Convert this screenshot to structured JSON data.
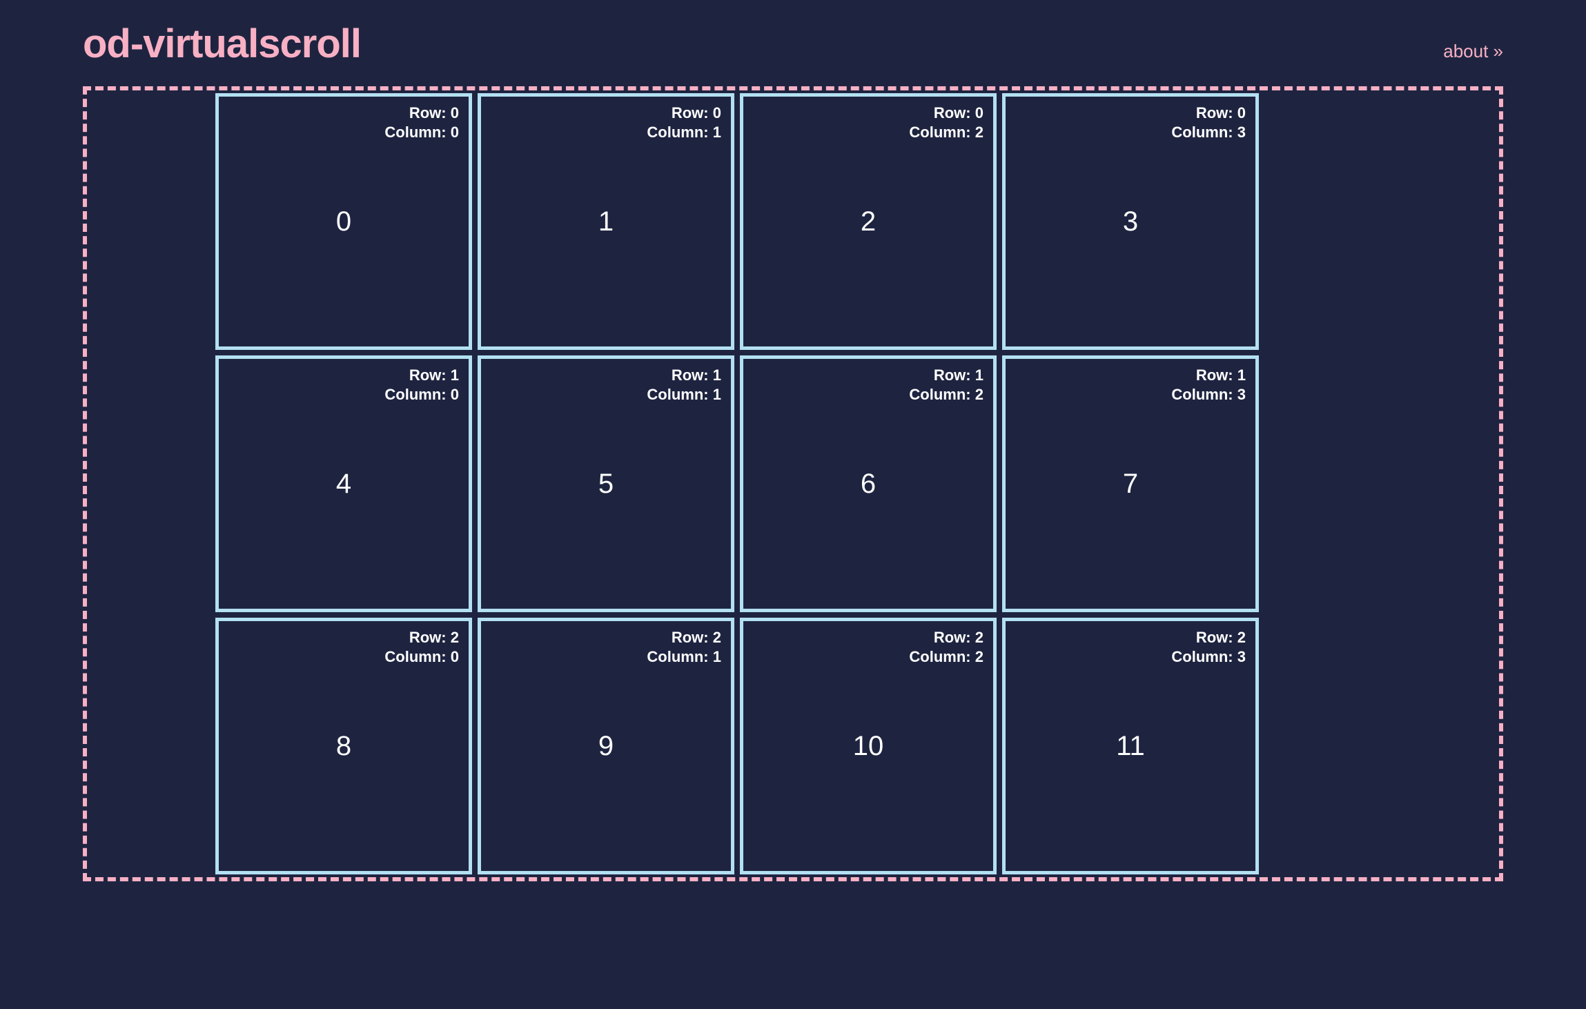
{
  "header": {
    "title": "od-virtualscroll",
    "about_label": "about »"
  },
  "labels": {
    "row_prefix": "Row: ",
    "col_prefix": "Column: "
  },
  "grid": {
    "rows": [
      {
        "row": 0,
        "cells": [
          {
            "row": 0,
            "col": 0,
            "index": 0
          },
          {
            "row": 0,
            "col": 1,
            "index": 1
          },
          {
            "row": 0,
            "col": 2,
            "index": 2
          },
          {
            "row": 0,
            "col": 3,
            "index": 3
          }
        ]
      },
      {
        "row": 1,
        "cells": [
          {
            "row": 1,
            "col": 0,
            "index": 4
          },
          {
            "row": 1,
            "col": 1,
            "index": 5
          },
          {
            "row": 1,
            "col": 2,
            "index": 6
          },
          {
            "row": 1,
            "col": 3,
            "index": 7
          }
        ]
      },
      {
        "row": 2,
        "cells": [
          {
            "row": 2,
            "col": 0,
            "index": 8
          },
          {
            "row": 2,
            "col": 1,
            "index": 9
          },
          {
            "row": 2,
            "col": 2,
            "index": 10
          },
          {
            "row": 2,
            "col": 3,
            "index": 11
          }
        ]
      }
    ]
  }
}
